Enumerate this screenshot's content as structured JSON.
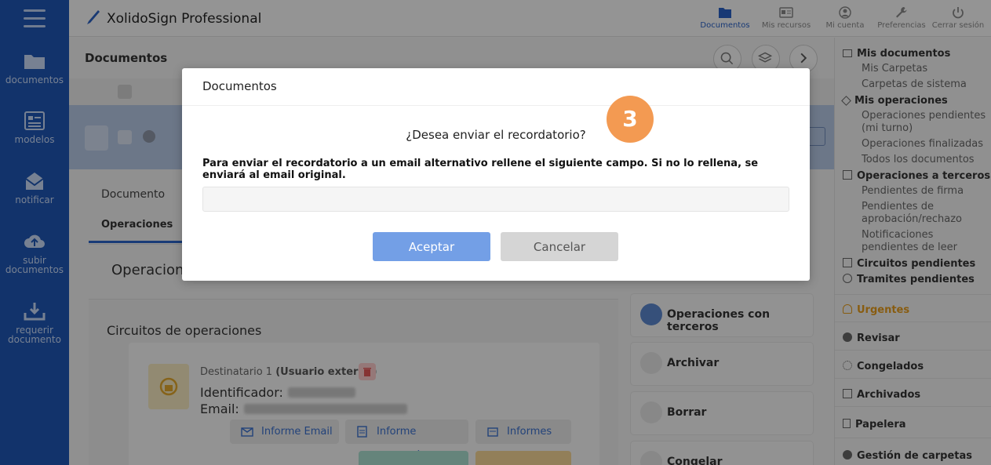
{
  "app": {
    "brand": "XolidoSign Professional"
  },
  "leftnav": {
    "items": [
      {
        "label": "documentos"
      },
      {
        "label": "modelos"
      },
      {
        "label": "notificar"
      },
      {
        "label": "subir documentos"
      },
      {
        "label": "requerir documento"
      }
    ]
  },
  "topmenu": {
    "items": [
      {
        "label": "Documentos",
        "icon": "folder-icon"
      },
      {
        "label": "Mis recursos",
        "icon": "id-card-icon"
      },
      {
        "label": "Mi cuenta",
        "icon": "user-icon"
      },
      {
        "label": "Preferencias",
        "icon": "wrench-icon"
      },
      {
        "label": "Cerrar sesión",
        "icon": "power-icon"
      }
    ]
  },
  "main": {
    "title": "Documentos",
    "tabs": {
      "documento": "Documento",
      "operaciones": "Operaciones"
    },
    "ops_heading": "Operaciones",
    "circuits_title": "Circuitos de operaciones",
    "recipient": {
      "label": "Destinatario 1",
      "type": "(Usuario externo)",
      "id_label": "Identificador:",
      "email_label": "Email:"
    },
    "actions": {
      "informe_email": "Informe Email",
      "informe_operacion": "Informe operación",
      "informes": "Informes"
    },
    "right_actions": [
      {
        "label": "Operaciones con terceros"
      },
      {
        "label": "Archivar"
      },
      {
        "label": "Borrar"
      },
      {
        "label": "Congelar"
      }
    ]
  },
  "sidebar": {
    "mis_documentos": "Mis documentos",
    "mis_carpetas": "Mis Carpetas",
    "carpetas_sistema": "Carpetas de sistema",
    "mis_operaciones": "Mis operaciones",
    "ops_pendientes": "Operaciones pendientes (mi turno)",
    "ops_finalizadas": "Operaciones finalizadas",
    "todos_docs": "Todos los documentos",
    "ops_terceros": "Operaciones a terceros",
    "pend_firma": "Pendientes de firma",
    "pend_aprobacion": "Pendientes de aprobación/rechazo",
    "notif_pendientes": "Notificaciones pendientes de leer",
    "circuitos_pend": "Circuitos pendientes",
    "tramites_pend": "Tramites pendientes",
    "urgentes": "Urgentes",
    "revisar": "Revisar",
    "congelados": "Congelados",
    "archivados": "Archivados",
    "papelera": "Papelera",
    "gestion": "Gestión de carpetas",
    "urgent_color": "#e39a1c"
  },
  "modal": {
    "title": "Documentos",
    "question": "¿Desea enviar el recordatorio?",
    "instructions": "Para enviar el recordatorio a un email alternativo rellene el siguiente campo. Si no lo rellena, se enviará al email original.",
    "input_value": "",
    "accept": "Aceptar",
    "cancel": "Cancelar",
    "step": "3"
  }
}
